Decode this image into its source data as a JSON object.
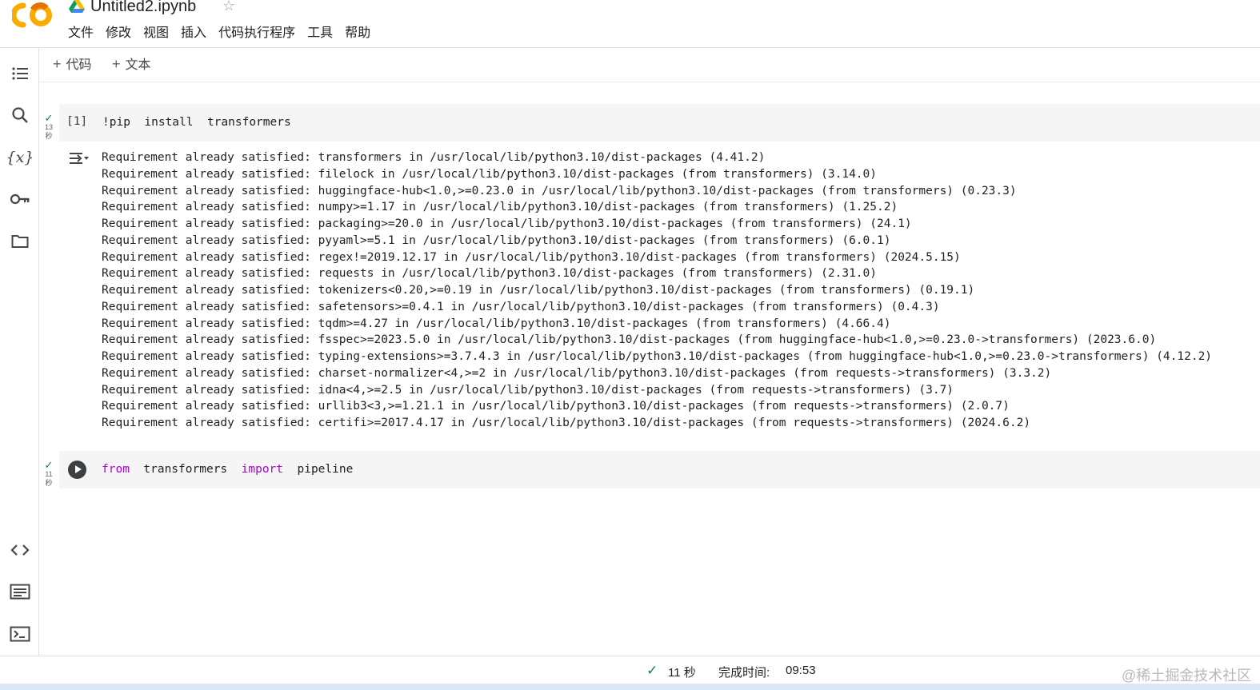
{
  "app": {
    "notebook_title": "Untitled2.ipynb",
    "logo_text": "CO"
  },
  "menu": {
    "items": [
      "文件",
      "修改",
      "视图",
      "插入",
      "代码执行程序",
      "工具",
      "帮助"
    ]
  },
  "toolbar": {
    "add_code_label": "代码",
    "add_text_label": "文本"
  },
  "cells": [
    {
      "execution_count": "[1]",
      "status_time": "13",
      "status_unit": "秒",
      "code": "!pip  install  transformers",
      "output": [
        "Requirement already satisfied: transformers in /usr/local/lib/python3.10/dist-packages (4.41.2)",
        "Requirement already satisfied: filelock in /usr/local/lib/python3.10/dist-packages (from transformers) (3.14.0)",
        "Requirement already satisfied: huggingface-hub<1.0,>=0.23.0 in /usr/local/lib/python3.10/dist-packages (from transformers) (0.23.3)",
        "Requirement already satisfied: numpy>=1.17 in /usr/local/lib/python3.10/dist-packages (from transformers) (1.25.2)",
        "Requirement already satisfied: packaging>=20.0 in /usr/local/lib/python3.10/dist-packages (from transformers) (24.1)",
        "Requirement already satisfied: pyyaml>=5.1 in /usr/local/lib/python3.10/dist-packages (from transformers) (6.0.1)",
        "Requirement already satisfied: regex!=2019.12.17 in /usr/local/lib/python3.10/dist-packages (from transformers) (2024.5.15)",
        "Requirement already satisfied: requests in /usr/local/lib/python3.10/dist-packages (from transformers) (2.31.0)",
        "Requirement already satisfied: tokenizers<0.20,>=0.19 in /usr/local/lib/python3.10/dist-packages (from transformers) (0.19.1)",
        "Requirement already satisfied: safetensors>=0.4.1 in /usr/local/lib/python3.10/dist-packages (from transformers) (0.4.3)",
        "Requirement already satisfied: tqdm>=4.27 in /usr/local/lib/python3.10/dist-packages (from transformers) (4.66.4)",
        "Requirement already satisfied: fsspec>=2023.5.0 in /usr/local/lib/python3.10/dist-packages (from huggingface-hub<1.0,>=0.23.0->transformers) (2023.6.0)",
        "Requirement already satisfied: typing-extensions>=3.7.4.3 in /usr/local/lib/python3.10/dist-packages (from huggingface-hub<1.0,>=0.23.0->transformers) (4.12.2)",
        "Requirement already satisfied: charset-normalizer<4,>=2 in /usr/local/lib/python3.10/dist-packages (from requests->transformers) (3.3.2)",
        "Requirement already satisfied: idna<4,>=2.5 in /usr/local/lib/python3.10/dist-packages (from requests->transformers) (3.7)",
        "Requirement already satisfied: urllib3<3,>=1.21.1 in /usr/local/lib/python3.10/dist-packages (from requests->transformers) (2.0.7)",
        "Requirement already satisfied: certifi>=2017.4.17 in /usr/local/lib/python3.10/dist-packages (from requests->transformers) (2024.6.2)"
      ]
    },
    {
      "status_time": "11",
      "status_unit": "秒",
      "code_tokens": {
        "kw_from": "from",
        "module": "transformers",
        "kw_import": "import",
        "name": "pipeline"
      }
    }
  ],
  "statusbar": {
    "duration": "11 秒",
    "completed_label": "完成时间:",
    "completed_time": "09:53",
    "watermark": "@稀土掘金技术社区"
  },
  "colors": {
    "logo_orange": "#f9ab00",
    "logo_dark_orange": "#e37400",
    "check_green": "#188038",
    "keyword_purple": "#af00db",
    "cell_bg": "#f5f5f5"
  },
  "icons": {
    "rail_top": [
      "toc-icon",
      "search-icon",
      "variables-icon",
      "key-icon",
      "folder-icon"
    ],
    "rail_bottom": [
      "code-snippets-icon",
      "command-palette-icon",
      "terminal-icon"
    ]
  }
}
